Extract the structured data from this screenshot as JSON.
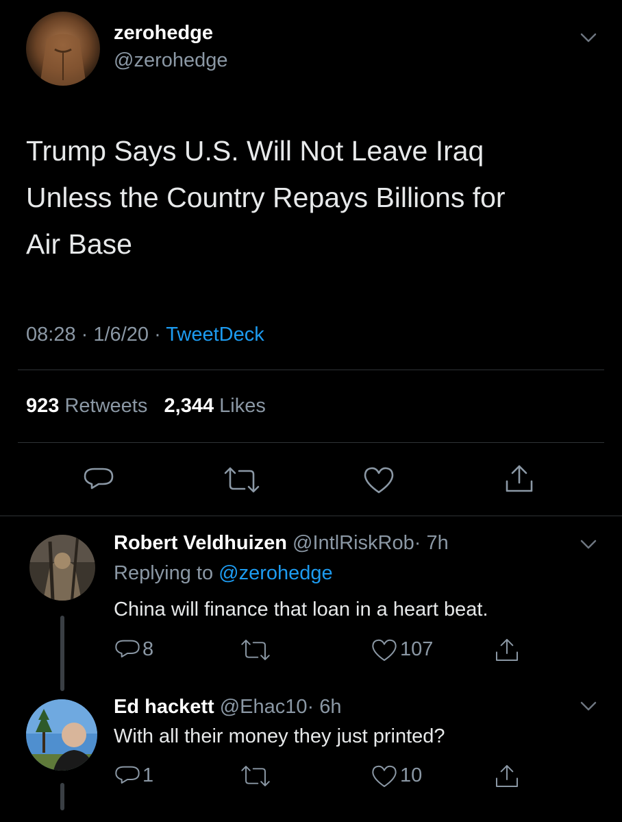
{
  "tweet": {
    "display_name": "zerohedge",
    "handle": "@zerohedge",
    "text_lines": [
      "Trump Says U.S. Will Not Leave Iraq",
      "Unless the Country Repays Billions for",
      "Air Base"
    ],
    "time": "08:28",
    "separator": "·",
    "date": "1/6/20",
    "source": "TweetDeck",
    "retweets_count": "923",
    "retweets_label": "Retweets",
    "likes_count": "2,344",
    "likes_label": "Likes"
  },
  "replies": [
    {
      "display_name": "Robert Veldhuizen",
      "handle": "@IntlRiskRob",
      "time": "· 7h",
      "replying_prefix": "Replying to",
      "replying_handle": "@zerohedge",
      "text": "China will finance that loan in a heart beat.",
      "reply_count": "8",
      "like_count": "107"
    },
    {
      "display_name": "Ed hackett",
      "handle": "@Ehac10",
      "time": "· 6h",
      "text": "With all their money they just printed?",
      "reply_count": "1",
      "like_count": "10"
    }
  ],
  "icons": {
    "dropdown": "chevron-down-icon",
    "reply": "reply-icon",
    "retweet": "retweet-icon",
    "like": "heart-icon",
    "share": "share-icon"
  },
  "colors": {
    "background": "#000000",
    "text": "#ffffff",
    "muted": "#8b98a5",
    "link": "#1d9bf0",
    "divider": "#2f3336"
  }
}
